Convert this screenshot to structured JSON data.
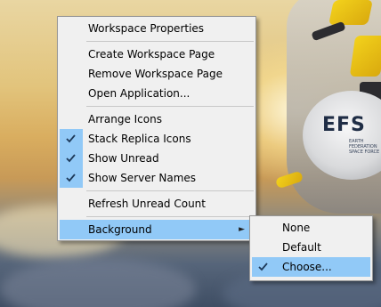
{
  "main_menu": {
    "items": [
      {
        "label": "Workspace Properties"
      },
      {
        "label": "Create Workspace Page"
      },
      {
        "label": "Remove Workspace Page"
      },
      {
        "label": "Open Application..."
      },
      {
        "label": "Arrange Icons"
      },
      {
        "label": "Stack Replica Icons",
        "checked": true
      },
      {
        "label": "Show Unread",
        "checked": true
      },
      {
        "label": "Show Server Names",
        "checked": true
      },
      {
        "label": "Refresh Unread Count"
      },
      {
        "label": "Background",
        "highlighted": true,
        "has_submenu": true
      }
    ]
  },
  "sub_menu": {
    "items": [
      {
        "label": "None"
      },
      {
        "label": "Default"
      },
      {
        "label": "Choose...",
        "checked": true,
        "highlighted": true
      }
    ]
  },
  "wallpaper": {
    "logo_text": "EFS",
    "logo_subtext": "EARTH FEDERATION SPACE FORCE"
  },
  "colors": {
    "menu_background": "#f0f0f0",
    "highlight": "#91c9f7",
    "checkmark": "#1e3a5a",
    "separator": "#c8c8c8"
  }
}
